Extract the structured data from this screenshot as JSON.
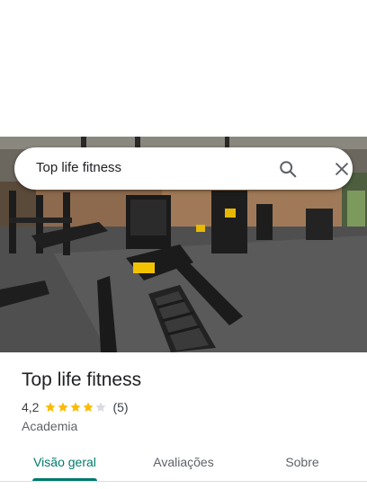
{
  "search": {
    "query": "Top life fitness",
    "search_icon": "search-icon",
    "close_icon": "close-icon"
  },
  "hero": {
    "photo": "gym-interior-photo"
  },
  "place": {
    "name": "Top life fitness",
    "rating": "4,2",
    "rating_stars": 4.2,
    "max_stars": 5,
    "review_count": "(5)",
    "category": "Academia"
  },
  "tabs": [
    {
      "label": "Visão geral",
      "active": true
    },
    {
      "label": "Avaliações",
      "active": false
    },
    {
      "label": "Sobre",
      "active": false
    }
  ],
  "colors": {
    "accent": "#00796b",
    "star_filled": "#fbbc04",
    "star_empty": "#dadce0",
    "text_primary": "#202124",
    "text_secondary": "#5f6368"
  }
}
